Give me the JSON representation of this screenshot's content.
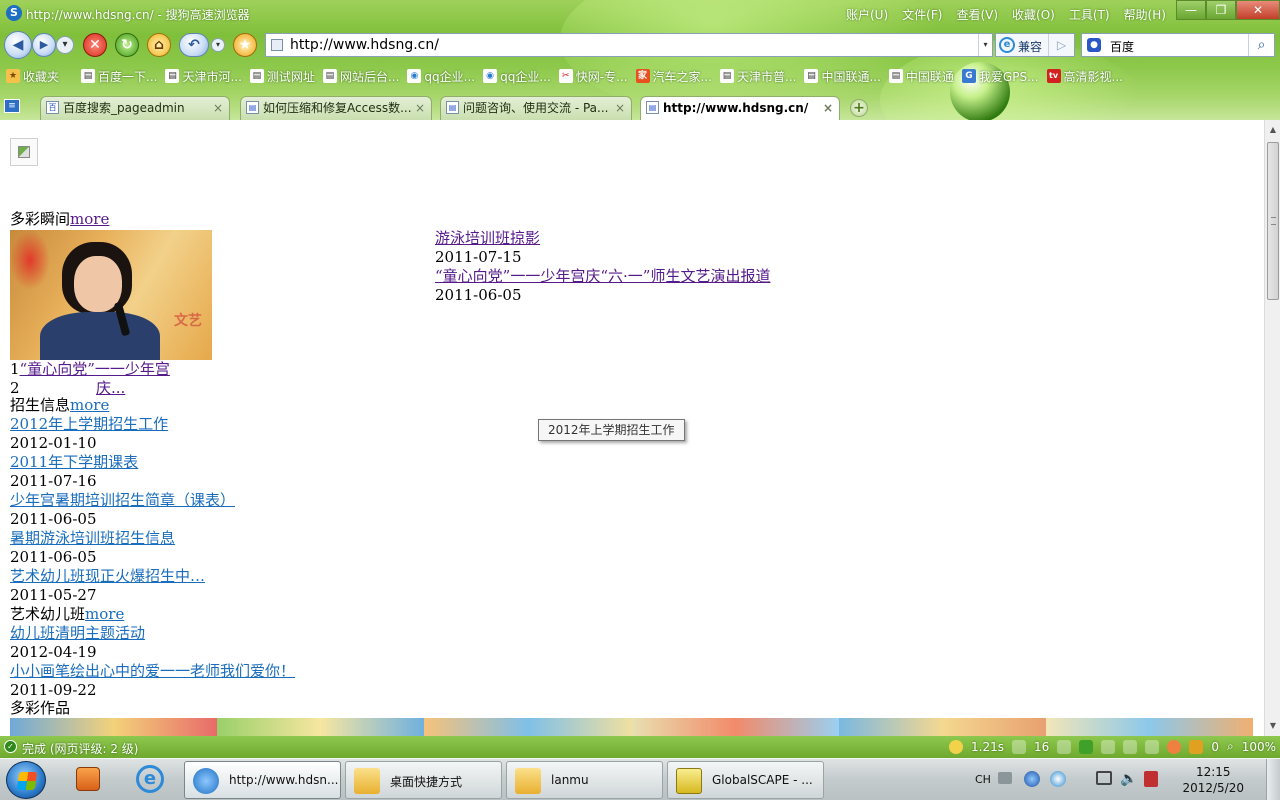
{
  "window": {
    "title": "http://www.hdsng.cn/ - 搜狗高速浏览器",
    "app_logo": "S",
    "menu": [
      "账户(U)",
      "文件(F)",
      "查看(V)",
      "收藏(O)",
      "工具(T)",
      "帮助(H)"
    ],
    "min": "—",
    "max": "❐",
    "close": "✕"
  },
  "toolbar": {
    "back": "◀",
    "forward": "▶",
    "dropdown": "▾",
    "stop": "✕",
    "refresh": "↻",
    "home": "⌂",
    "undo": "↶",
    "favorite": "★",
    "address": "http://www.hdsng.cn/",
    "compat_label": "兼容",
    "compat_icon": "e",
    "go": "▷",
    "search_engine": "百度",
    "search_icon": "🔍"
  },
  "favorites": {
    "items": [
      {
        "label": "收藏夹",
        "icon": "★",
        "color": "#e8a820"
      },
      {
        "label": "百度一下...",
        "icon": "▤",
        "color": "#ffffff"
      },
      {
        "label": "天津市河...",
        "icon": "▤",
        "color": "#ffffff"
      },
      {
        "label": "测试网址",
        "icon": "▤",
        "color": "#ffffff"
      },
      {
        "label": "网站后台...",
        "icon": "▤",
        "color": "#ffffff"
      },
      {
        "label": "qq企业...",
        "icon": "◉",
        "color": "#ffffff"
      },
      {
        "label": "qq企业...",
        "icon": "◉",
        "color": "#ffffff"
      },
      {
        "label": "快网-专...",
        "icon": "✂",
        "color": "#ffffff"
      },
      {
        "label": "汽车之家...",
        "icon": "家",
        "color": "#e8501e"
      },
      {
        "label": "天津市普...",
        "icon": "▤",
        "color": "#ffffff"
      },
      {
        "label": "中国联通...",
        "icon": "▤",
        "color": "#ffffff"
      },
      {
        "label": "中国联通",
        "icon": "▤",
        "color": "#ffffff"
      },
      {
        "label": "我爱GPS...",
        "icon": "G",
        "color": "#3a7ad0"
      },
      {
        "label": "高清影视...",
        "icon": "tv",
        "color": "#d32020"
      }
    ]
  },
  "tabs": {
    "list_icon": "≡",
    "items": [
      {
        "label": "百度搜索_pageadmin",
        "icon": "百",
        "close": "×",
        "active": false
      },
      {
        "label": "如何压缩和修复Access数...",
        "icon": "▤",
        "close": "×",
        "active": false
      },
      {
        "label": "问题咨询、使用交流 - Pa...",
        "icon": "▤",
        "close": "×",
        "active": false
      },
      {
        "label": "http://www.hdsng.cn/",
        "icon": "▤",
        "close": "×",
        "active": true
      }
    ],
    "new_tab": "+"
  },
  "content": {
    "section_moments": {
      "title": "多彩瞬间",
      "more": "more"
    },
    "photo_caption_text": "文艺",
    "slide_num_1": "1",
    "slide_caption_line1": "“童心向党”一一少年宫",
    "slide_caption_line2": "庆...",
    "slide_num_2": "2",
    "news": [
      {
        "title": "游泳培训班掠影",
        "date": "2011-07-15"
      },
      {
        "title": "“童心向党”一一少年宫庆“六·一”师生文艺演出报道",
        "date": "2011-06-05"
      }
    ],
    "section_enroll": {
      "title": "招生信息",
      "more": "more"
    },
    "enroll": [
      {
        "title": "2012年上学期招生工作",
        "date": "2012-01-10"
      },
      {
        "title": "2011年下学期课表",
        "date": "2011-07-16"
      },
      {
        "title": "少年宫暑期培训招生简章（课表）",
        "date": "2011-06-05"
      },
      {
        "title": "暑期游泳培训班招生信息",
        "date": "2011-06-05"
      },
      {
        "title": "艺术幼儿班现正火爆招生中…",
        "date": "2011-05-27"
      }
    ],
    "section_kids": {
      "title": "艺术幼儿班",
      "more": "more"
    },
    "kids": [
      {
        "title": "幼儿班清明主题活动",
        "date": "2012-04-19"
      },
      {
        "title": "小小画笔绘出心中的爱一一老师我们爱你！",
        "date": "2011-09-22"
      }
    ],
    "section_works": {
      "title": "多彩作品"
    },
    "tooltip": "2012年上学期招生工作"
  },
  "scrollbar": {
    "up": "▲",
    "down": "▼"
  },
  "status": {
    "text": "完成 (网页评级: 2 级)",
    "ok_icon": "✓",
    "speed": "1.21s",
    "count": "16",
    "block_count": "0",
    "zoom": "100%"
  },
  "taskbar": {
    "tasks": [
      {
        "label": "http://www.hdsn...",
        "active": true,
        "color": "#2a7ad0"
      },
      {
        "label": "桌面快捷方式",
        "active": false,
        "color": "#f1c84a"
      },
      {
        "label": "lanmu",
        "active": false,
        "color": "#f1c84a"
      },
      {
        "label": "GlobalSCAPE - ...",
        "active": false,
        "color": "#e8d24a"
      }
    ],
    "ime": "CH",
    "time": "12:15",
    "date": "2012/5/20"
  },
  "colors": {
    "chrome_green": "#8cc84a",
    "link_blue": "#1a6dbd",
    "link_visited": "#551a8b"
  }
}
